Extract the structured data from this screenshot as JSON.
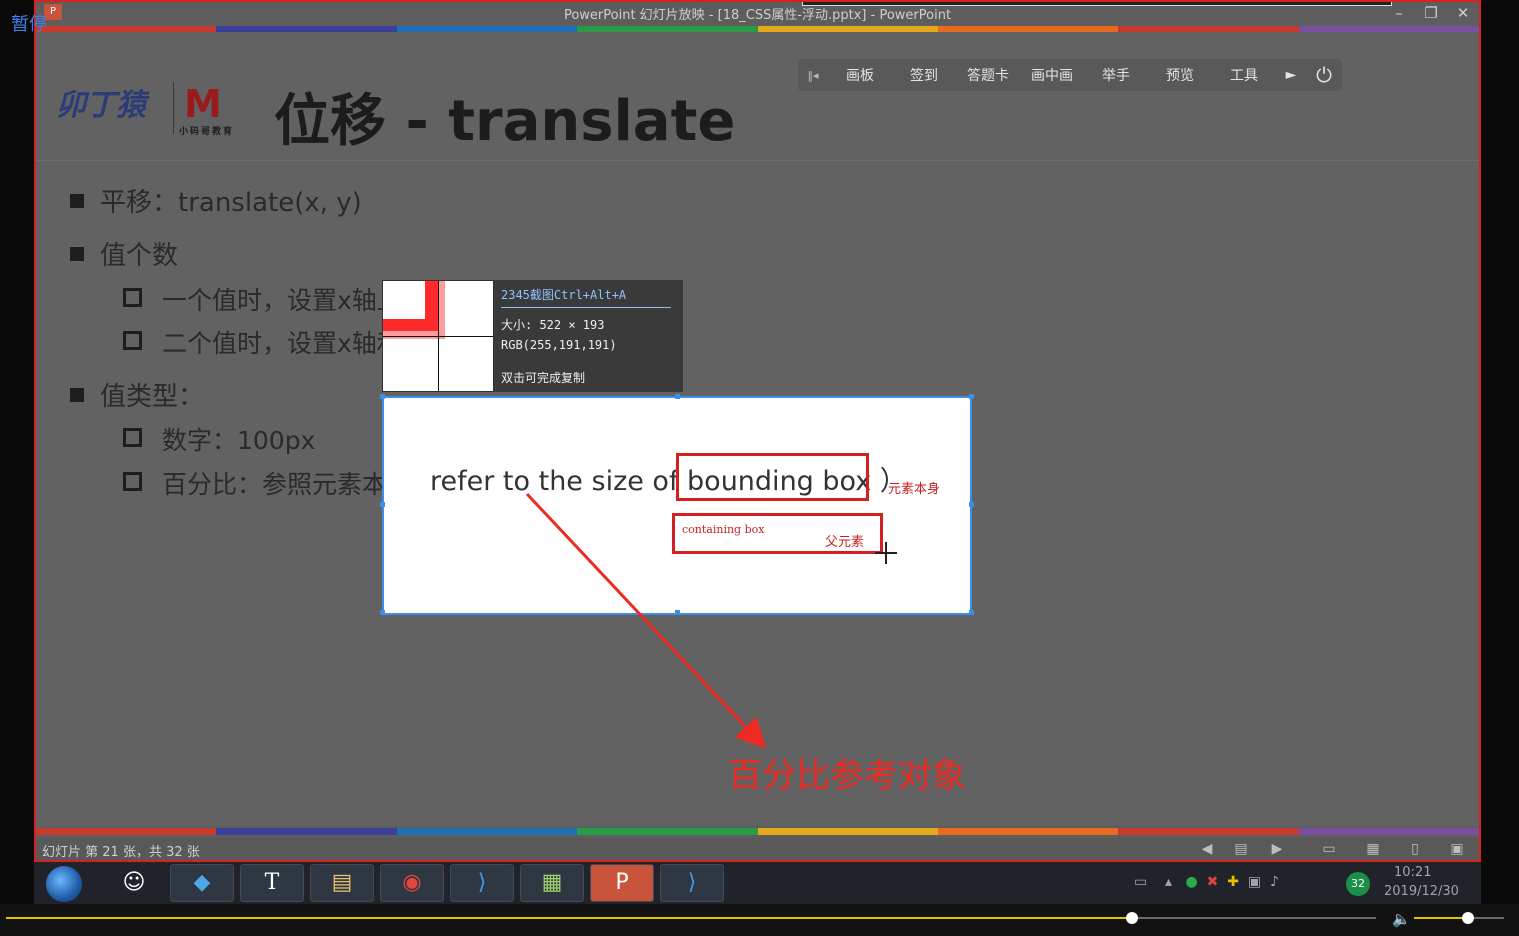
{
  "overlay": {
    "pause_label": "暂停"
  },
  "window": {
    "title": "PowerPoint 幻灯片放映 - [18_CSS属性-浮动.pptx] - PowerPoint",
    "app_icon": "P",
    "minimize_icon": "minimize-icon",
    "restore_icon": "restore-icon",
    "close_icon": "close-icon"
  },
  "rainbow_colors": [
    "#c9392d",
    "#3a3f9a",
    "#1f6fb5",
    "#2a9c48",
    "#e4a81b",
    "#e86a1e",
    "#c9392d",
    "#7a4fa0"
  ],
  "slide": {
    "logo1": "卯丁猿",
    "logo2": "M",
    "logo2_sub": "小码哥教育",
    "title": "位移 - translate",
    "bullets": {
      "b1": "平移：translate(x, y)",
      "b2": "值个数",
      "b2_1": "一个值时，设置x轴上",
      "b2_2": "二个值时，设置x轴和",
      "b3": "值类型：",
      "b3_1": "数字：100px",
      "b3_2": "百分比：参照元素本身（"
    },
    "bbox_ref": "refer to the size of bounding box ）",
    "label_self": "元素本身",
    "containing_box": "containing box",
    "parent_label": "父元素",
    "percent_reference": "百分比参考对象",
    "accent_color": "#ee2b22"
  },
  "slide_toolbar": {
    "items": [
      "画板",
      "签到",
      "答题卡",
      "画中画",
      "举手",
      "预览",
      "工具"
    ],
    "arrow": "►",
    "power_icon": "power-icon"
  },
  "capture_info": {
    "title": "2345截图Ctrl+Alt+A",
    "size": "大小: 522 × 193",
    "rgb": "RGB(255,191,191)",
    "hint": "双击可完成复制"
  },
  "statusbar": {
    "text": "幻灯片 第 21 张，共 32 张"
  },
  "taskbar": {
    "apps": [
      "avatar-icon",
      "video-app-icon",
      "typora-icon",
      "file-manager-icon",
      "chrome-icon",
      "vscode-icon",
      "notes-icon",
      "powerpoint-icon",
      "vscode-icon"
    ],
    "typora_glyph": "T",
    "ppt_glyph": "P",
    "tray_badge": "32",
    "time": "10:21",
    "date": "2019/12/30"
  },
  "player": {
    "progress_fraction": 0.822,
    "volume_fraction": 0.6,
    "volume_icon": "speaker-icon"
  }
}
